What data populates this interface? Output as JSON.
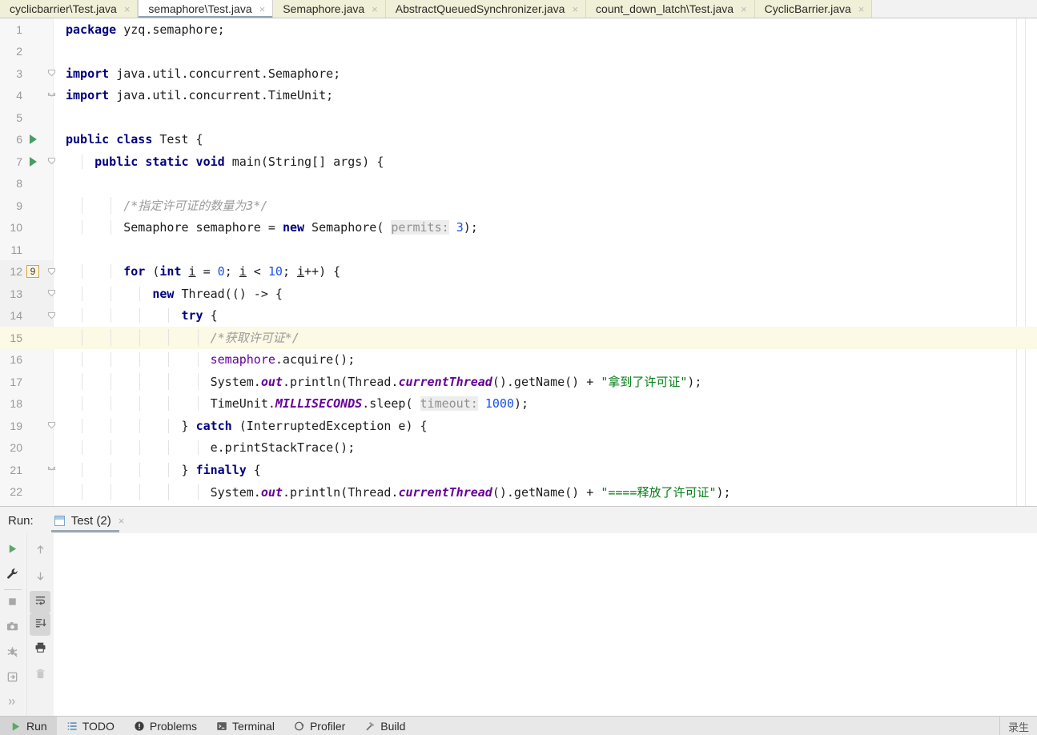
{
  "tabs": [
    {
      "label": "cyclicbarrier\\Test.java",
      "active": false,
      "close": "×"
    },
    {
      "label": "semaphore\\Test.java",
      "active": true,
      "close": "×"
    },
    {
      "label": "Semaphore.java",
      "active": false,
      "close": "×"
    },
    {
      "label": "AbstractQueuedSynchronizer.java",
      "active": false,
      "close": "×"
    },
    {
      "label": "count_down_latch\\Test.java",
      "active": false,
      "close": "×"
    },
    {
      "label": "CyclicBarrier.java",
      "active": false,
      "close": "×"
    }
  ],
  "editor": {
    "language": "java",
    "caret_line": 15,
    "lines": [
      {
        "n": "1",
        "marker": "",
        "fold": "",
        "indents": 0,
        "highlight": false,
        "tokens": [
          {
            "t": "package",
            "c": "kw"
          },
          {
            "t": " yzq.semaphore;",
            "c": "pln"
          }
        ]
      },
      {
        "n": "2",
        "marker": "",
        "fold": "",
        "indents": 0,
        "highlight": false,
        "tokens": []
      },
      {
        "n": "3",
        "marker": "",
        "fold": "fold-open",
        "indents": 0,
        "highlight": false,
        "tokens": [
          {
            "t": "import",
            "c": "kw"
          },
          {
            "t": " java.util.concurrent.Semaphore;",
            "c": "pln"
          }
        ]
      },
      {
        "n": "4",
        "marker": "",
        "fold": "fold-end",
        "indents": 0,
        "highlight": false,
        "tokens": [
          {
            "t": "import",
            "c": "kw"
          },
          {
            "t": " java.util.concurrent.TimeUnit;",
            "c": "pln"
          }
        ]
      },
      {
        "n": "5",
        "marker": "",
        "fold": "",
        "indents": 0,
        "highlight": false,
        "tokens": []
      },
      {
        "n": "6",
        "marker": "run",
        "fold": "",
        "indents": 0,
        "highlight": false,
        "tokens": [
          {
            "t": "public class",
            "c": "kw"
          },
          {
            "t": " Test {",
            "c": "pln"
          }
        ]
      },
      {
        "n": "7",
        "marker": "run",
        "fold": "fold-open",
        "indents": 1,
        "highlight": false,
        "tokens": [
          {
            "t": "    ",
            "c": "pln"
          },
          {
            "t": "public static void",
            "c": "kw"
          },
          {
            "t": " main(String[] args) {",
            "c": "pln"
          }
        ]
      },
      {
        "n": "8",
        "marker": "",
        "fold": "",
        "indents": 1,
        "highlight": false,
        "tokens": []
      },
      {
        "n": "9",
        "marker": "",
        "fold": "",
        "indents": 2,
        "highlight": false,
        "tokens": [
          {
            "t": "        /*指定许可证的数量为3*/",
            "c": "cmt"
          }
        ]
      },
      {
        "n": "10",
        "marker": "",
        "fold": "",
        "indents": 2,
        "highlight": false,
        "tokens": [
          {
            "t": "        Semaphore semaphore = ",
            "c": "pln"
          },
          {
            "t": "new",
            "c": "kw"
          },
          {
            "t": " Semaphore( ",
            "c": "pln"
          },
          {
            "t": "permits:",
            "c": "hint"
          },
          {
            "t": " ",
            "c": "pln"
          },
          {
            "t": "3",
            "c": "num"
          },
          {
            "t": ");",
            "c": "pln"
          }
        ]
      },
      {
        "n": "11",
        "marker": "",
        "fold": "",
        "indents": 2,
        "highlight": false,
        "tokens": []
      },
      {
        "n": "12",
        "marker": "badge9",
        "fold": "fold-open",
        "indents": 2,
        "highlight": false,
        "tokens": [
          {
            "t": "        ",
            "c": "pln"
          },
          {
            "t": "for",
            "c": "kw"
          },
          {
            "t": " (",
            "c": "pln"
          },
          {
            "t": "int",
            "c": "kw"
          },
          {
            "t": " ",
            "c": "pln"
          },
          {
            "t": "i",
            "c": "var-u"
          },
          {
            "t": " = ",
            "c": "pln"
          },
          {
            "t": "0",
            "c": "num"
          },
          {
            "t": "; ",
            "c": "pln"
          },
          {
            "t": "i",
            "c": "var-u"
          },
          {
            "t": " < ",
            "c": "pln"
          },
          {
            "t": "10",
            "c": "num"
          },
          {
            "t": "; ",
            "c": "pln"
          },
          {
            "t": "i",
            "c": "var-u"
          },
          {
            "t": "++) {",
            "c": "pln"
          }
        ]
      },
      {
        "n": "13",
        "marker": "",
        "fold": "fold-open",
        "indents": 3,
        "highlight": false,
        "tokens": [
          {
            "t": "            ",
            "c": "pln"
          },
          {
            "t": "new",
            "c": "kw"
          },
          {
            "t": " Thread(() -> {",
            "c": "pln"
          }
        ]
      },
      {
        "n": "14",
        "marker": "",
        "fold": "fold-open",
        "indents": 4,
        "highlight": false,
        "tokens": [
          {
            "t": "                ",
            "c": "pln"
          },
          {
            "t": "try",
            "c": "kw"
          },
          {
            "t": " {",
            "c": "pln"
          }
        ]
      },
      {
        "n": "15",
        "marker": "",
        "fold": "",
        "indents": 5,
        "highlight": true,
        "tokens": [
          {
            "t": "                    /*获取许可证*/",
            "c": "cmt"
          }
        ]
      },
      {
        "n": "16",
        "marker": "",
        "fold": "",
        "indents": 5,
        "highlight": false,
        "tokens": [
          {
            "t": "                    ",
            "c": "pln"
          },
          {
            "t": "semaphore",
            "c": "fld"
          },
          {
            "t": ".acquire();",
            "c": "pln"
          }
        ]
      },
      {
        "n": "17",
        "marker": "",
        "fold": "",
        "indents": 5,
        "highlight": false,
        "tokens": [
          {
            "t": "                    System.",
            "c": "pln"
          },
          {
            "t": "out",
            "c": "stat"
          },
          {
            "t": ".println(Thread.",
            "c": "pln"
          },
          {
            "t": "currentThread",
            "c": "stat"
          },
          {
            "t": "().getName() + ",
            "c": "pln"
          },
          {
            "t": "\"拿到了许可证\"",
            "c": "str"
          },
          {
            "t": ");",
            "c": "pln"
          }
        ]
      },
      {
        "n": "18",
        "marker": "",
        "fold": "",
        "indents": 5,
        "highlight": false,
        "tokens": [
          {
            "t": "                    TimeUnit.",
            "c": "pln"
          },
          {
            "t": "MILLISECONDS",
            "c": "stat"
          },
          {
            "t": ".sleep( ",
            "c": "pln"
          },
          {
            "t": "timeout:",
            "c": "hint"
          },
          {
            "t": " ",
            "c": "pln"
          },
          {
            "t": "1000",
            "c": "num"
          },
          {
            "t": ");",
            "c": "pln"
          }
        ]
      },
      {
        "n": "19",
        "marker": "",
        "fold": "fold-open",
        "indents": 4,
        "highlight": false,
        "tokens": [
          {
            "t": "                } ",
            "c": "pln"
          },
          {
            "t": "catch",
            "c": "kw"
          },
          {
            "t": " (InterruptedException e) {",
            "c": "pln"
          }
        ]
      },
      {
        "n": "20",
        "marker": "",
        "fold": "",
        "indents": 5,
        "highlight": false,
        "tokens": [
          {
            "t": "                    e.printStackTrace();",
            "c": "pln"
          }
        ]
      },
      {
        "n": "21",
        "marker": "",
        "fold": "fold-end",
        "indents": 4,
        "highlight": false,
        "tokens": [
          {
            "t": "                } ",
            "c": "pln"
          },
          {
            "t": "finally",
            "c": "kw"
          },
          {
            "t": " {",
            "c": "pln"
          }
        ]
      },
      {
        "n": "22",
        "marker": "",
        "fold": "",
        "indents": 5,
        "highlight": false,
        "tokens": [
          {
            "t": "                    System.",
            "c": "pln"
          },
          {
            "t": "out",
            "c": "stat"
          },
          {
            "t": ".println(Thread.",
            "c": "pln"
          },
          {
            "t": "currentThread",
            "c": "stat"
          },
          {
            "t": "().getName() + ",
            "c": "pln"
          },
          {
            "t": "\"====释放了许可证\"",
            "c": "str"
          },
          {
            "t": ");",
            "c": "pln"
          }
        ]
      }
    ]
  },
  "run_panel": {
    "label": "Run:",
    "tab_label": "Test (2)",
    "tab_close": "×",
    "console_text": "",
    "toolbar_left": [
      {
        "name": "rerun-button",
        "icon": "play-icon"
      },
      {
        "name": "configure-button",
        "icon": "wrench-icon"
      },
      {
        "name": "stop-button",
        "icon": "stop-icon"
      },
      {
        "name": "screenshot-button",
        "icon": "camera-icon"
      },
      {
        "name": "thread-dump-button",
        "icon": "bug-icon"
      },
      {
        "name": "export-button",
        "icon": "export-icon"
      },
      {
        "name": "more-button",
        "icon": "chevrons-right-icon"
      }
    ],
    "toolbar_right": [
      {
        "name": "up-button",
        "icon": "arrow-up-icon",
        "selected": false
      },
      {
        "name": "down-button",
        "icon": "arrow-down-icon",
        "selected": false
      },
      {
        "name": "soft-wrap-button",
        "icon": "wrap-icon",
        "selected": true
      },
      {
        "name": "scroll-end-button",
        "icon": "scroll-down-icon",
        "selected": true
      },
      {
        "name": "print-button",
        "icon": "printer-icon",
        "selected": false
      },
      {
        "name": "clear-button",
        "icon": "trash-icon",
        "selected": false
      }
    ]
  },
  "statusbar": {
    "items": [
      {
        "label": "Run",
        "icon": "play-icon",
        "active": true
      },
      {
        "label": "TODO",
        "icon": "list-icon",
        "active": false
      },
      {
        "label": "Problems",
        "icon": "warning-icon",
        "active": false
      },
      {
        "label": "Terminal",
        "icon": "terminal-icon",
        "active": false
      },
      {
        "label": "Profiler",
        "icon": "profiler-icon",
        "active": false
      },
      {
        "label": "Build",
        "icon": "hammer-icon",
        "active": false
      }
    ],
    "right_text": "录生"
  },
  "colors": {
    "keyword": "#000080",
    "string": "#067d17",
    "comment": "#9b9b9b",
    "number": "#1750eb",
    "field": "#660099",
    "caret_line": "#fcf9e4",
    "tab_inactive": "#f0f0d8",
    "accent": "#4a9e63"
  }
}
